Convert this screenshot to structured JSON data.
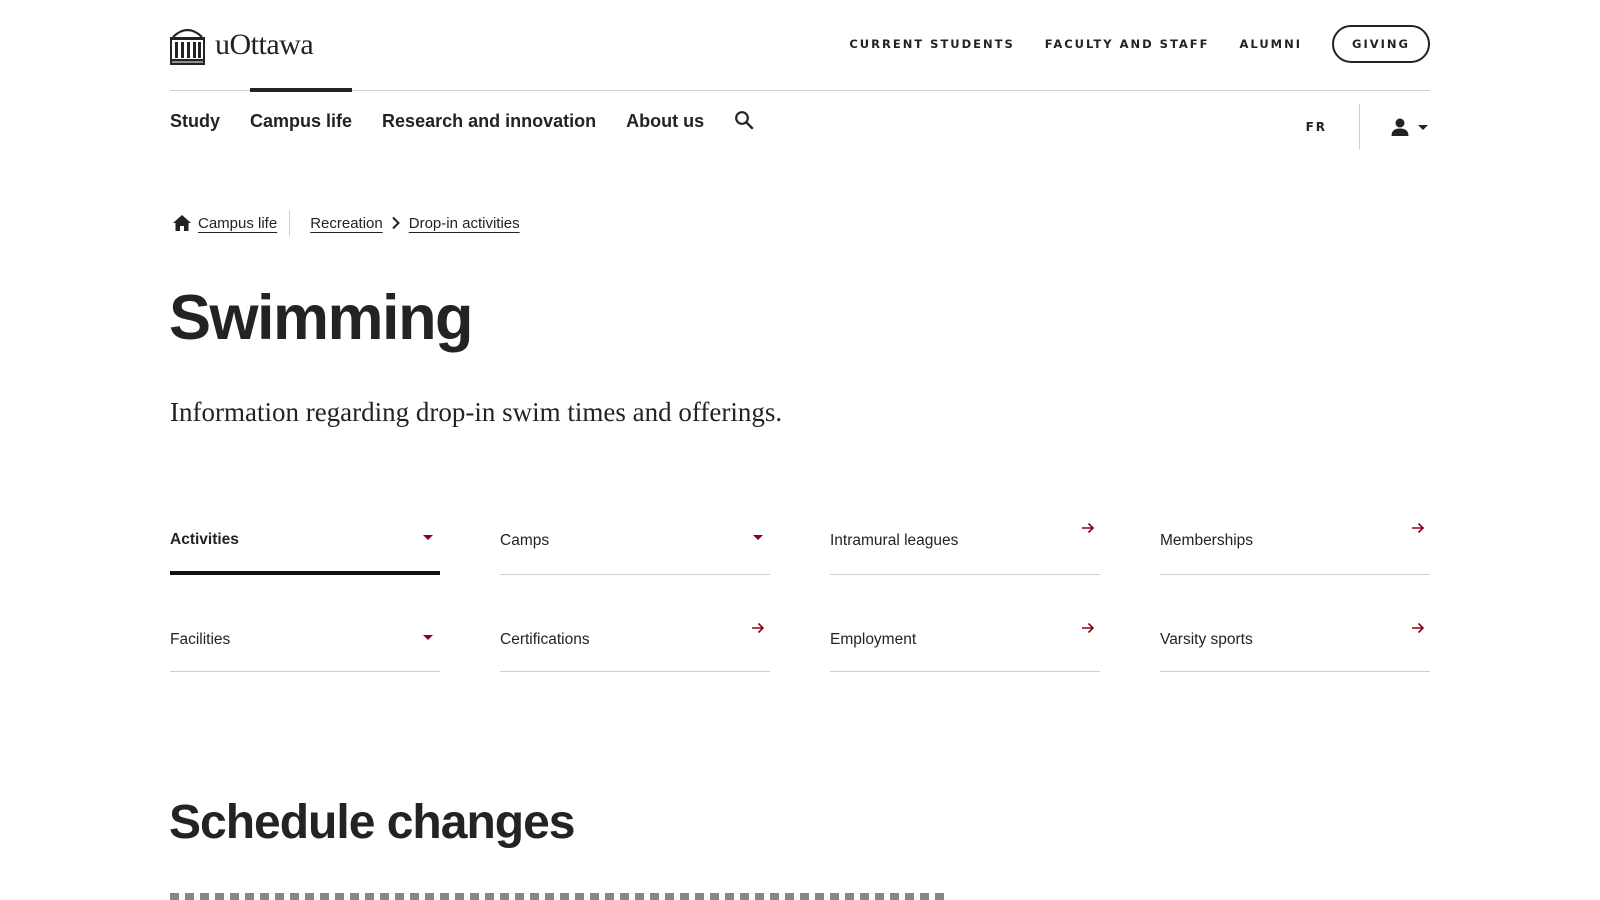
{
  "header": {
    "logo_text": "uOttawa",
    "utility_links": [
      "CURRENT STUDENTS",
      "FACULTY AND STAFF",
      "ALUMNI"
    ],
    "giving_label": "GIVING"
  },
  "nav": {
    "items": [
      "Study",
      "Campus life",
      "Research and innovation",
      "About us"
    ],
    "active": "Campus life",
    "lang": "FR"
  },
  "breadcrumb": {
    "home": "Campus life",
    "items": [
      "Recreation",
      "Drop-in activities"
    ]
  },
  "page": {
    "title": "Swimming",
    "lede": "Information regarding drop-in swim times and offerings."
  },
  "tiles": [
    {
      "label": "Activities",
      "icon": "caret-down-icon"
    },
    {
      "label": "Camps",
      "icon": "caret-down-icon"
    },
    {
      "label": "Intramural leagues",
      "icon": "arrow-right-icon"
    },
    {
      "label": "Memberships",
      "icon": "arrow-right-icon"
    },
    {
      "label": "Facilities",
      "icon": "caret-down-icon"
    },
    {
      "label": "Certifications",
      "icon": "arrow-right-icon"
    },
    {
      "label": "Employment",
      "icon": "arrow-right-icon"
    },
    {
      "label": "Varsity sports",
      "icon": "arrow-right-icon"
    }
  ],
  "section": {
    "heading": "Schedule changes"
  },
  "colors": {
    "text": "#232323",
    "accent": "#8f001a",
    "rule": "#cfcfcf"
  }
}
